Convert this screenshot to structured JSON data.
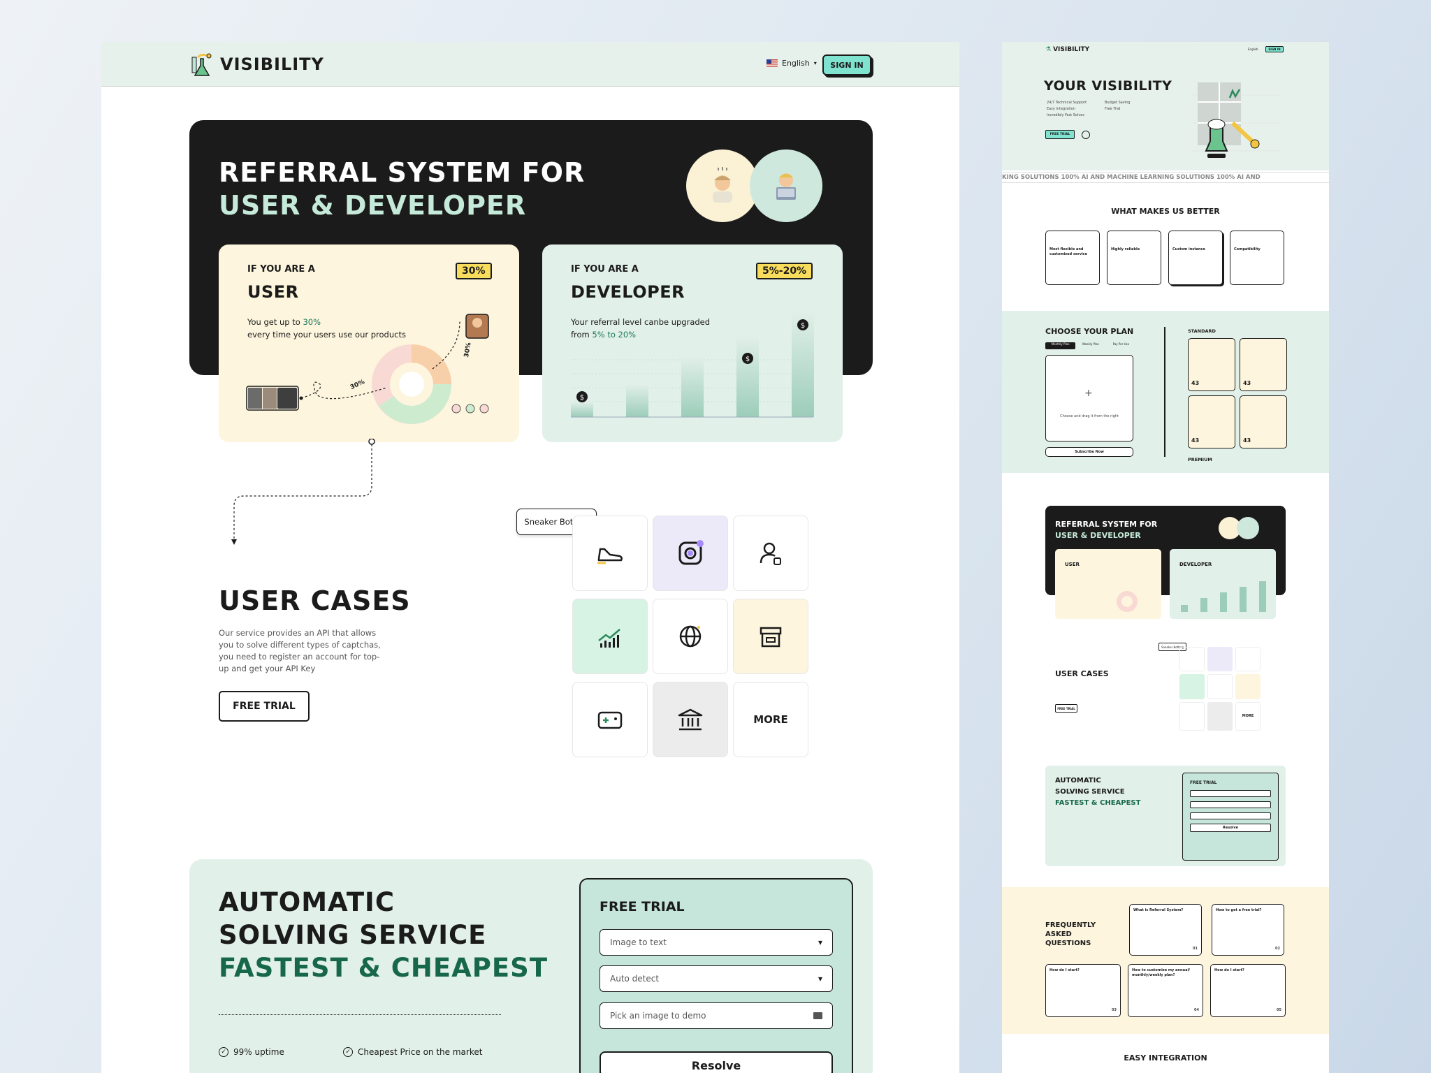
{
  "nav": {
    "brand": "VISIBILITY",
    "language": "English",
    "signin": "SIGN IN"
  },
  "referral": {
    "title_line1": "REFERRAL SYSTEM FOR",
    "title_line2": "USER & DEVELOPER",
    "user": {
      "kicker": "IF YOU ARE A",
      "title": "USER",
      "badge": "30%",
      "desc_pre": "You get up to ",
      "desc_hl": "30%",
      "desc_post": "every time your users use our products",
      "arrow_label_1": "30%",
      "arrow_label_2": "30%"
    },
    "developer": {
      "kicker": "IF YOU ARE A",
      "title": "DEVELOPER",
      "badge": "5%-20%",
      "desc_line1": "Your referral level canbe upgraded",
      "desc_pre": "from ",
      "desc_hl": "5% to 20%",
      "coin": "$"
    }
  },
  "cases": {
    "title": "USER CASES",
    "desc": "Our service provides an API that allows you to solve different types of captchas, you need to register an account for top-up and get your API Key",
    "cta": "FREE TRIAL",
    "tooltip": "Sneaker Botting",
    "more": "MORE"
  },
  "auto": {
    "line1": "AUTOMATIC",
    "line2": "SOLVING SERVICE",
    "line3": "FASTEST & CHEAPEST",
    "features": [
      "99% uptime",
      "Cheapest Price on the market"
    ],
    "trial": {
      "title": "FREE TRIAL",
      "select1": "Image to text",
      "select2": "Auto detect",
      "upload": "Pick an image to demo",
      "button": "Resolve"
    }
  },
  "side": {
    "brand": "VISIBILITY",
    "lang": "English",
    "signin": "SIGN IN",
    "hero_title": "YOUR VISIBILITY",
    "hero_features": [
      "24/7 Technical Support",
      "Budget Saving",
      "Easy Integration",
      "Free Trial",
      "Incredibly Fast Solves"
    ],
    "hero_cta": "FREE TRIAL",
    "marquee": "KING SOLUTIONS   100% AI AND MACHINE LEARNING SOLUTIONS   100% AI AND",
    "better_title": "WHAT MAKES US BETTER",
    "better_cards": [
      "Most flexible and customized service",
      "Highly reliable",
      "Custom instance",
      "Compatibility"
    ],
    "plan_title": "CHOOSE YOUR PLAN",
    "plan_tabs": [
      "Monthly Plan",
      "Weekly Plan",
      "Pay Per Use"
    ],
    "plan_upload": "Choose and drag it from the right",
    "plan_subscribe": "Subscribe Now",
    "plan_standard": "STANDARD",
    "plan_premium": "PREMIUM",
    "plan_price": "43",
    "ref_title1": "REFERRAL SYSTEM FOR",
    "ref_title2": "USER & DEVELOPER",
    "ref_user": "USER",
    "ref_dev": "DEVELOPER",
    "cases_title": "USER CASES",
    "cases_cta": "FREE TRIAL",
    "cases_tip": "Sneaker Botting",
    "cases_more": "MORE",
    "auto1": "AUTOMATIC",
    "auto2": "SOLVING SERVICE",
    "auto3": "FASTEST & CHEAPEST",
    "auto_trial": "FREE TRIAL",
    "auto_resolve": "Resolve",
    "faq_title": "FREQUENTLY ASKED QUESTIONS",
    "faq_cards": [
      {
        "q": "What is Referral System?",
        "n": "01"
      },
      {
        "q": "How to get a free trial?",
        "n": "02"
      },
      {
        "q": "How do I start?",
        "n": "03"
      },
      {
        "q": "How to customize my annual/ monthly/weekly plan?",
        "n": "04"
      },
      {
        "q": "How do I start?",
        "n": "05"
      }
    ],
    "integration": "EASY INTEGRATION"
  }
}
